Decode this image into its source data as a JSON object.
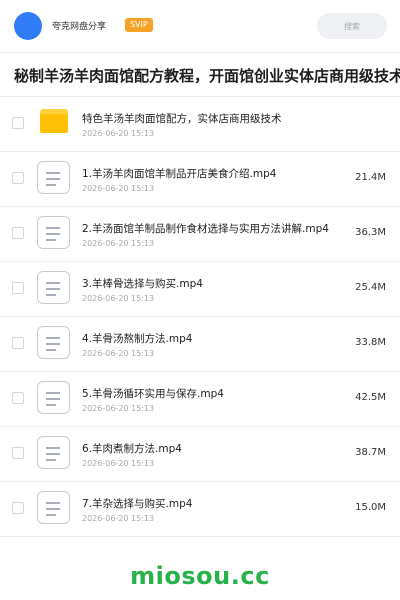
{
  "header": {
    "app_name": "夸克网盘分享",
    "badge": "SVIP",
    "search_placeholder": "搜索"
  },
  "page": {
    "title": "秘制羊汤羊肉面馆配方教程，开面馆创业实体店商用级技术"
  },
  "colors": {
    "accent": "#2f7cf6",
    "badge": "#f6a128",
    "folder": "#ffc107",
    "watermark": "#27b24a"
  },
  "files": [
    {
      "type": "folder",
      "icon": "folder-icon",
      "name": "特色羊汤羊肉面馆配方，实体店商用级技术",
      "date": "2026-06-20 15:13",
      "size": ""
    },
    {
      "type": "file",
      "icon": "file-icon",
      "name": "1.羊汤羊肉面馆羊制品开店美食介绍.mp4",
      "date": "2026-06-20 15:13",
      "size": "21.4M"
    },
    {
      "type": "file",
      "icon": "file-icon",
      "name": "2.羊汤面馆羊制品制作食材选择与实用方法讲解.mp4",
      "date": "2026-06-20 15:13",
      "size": "36.3M"
    },
    {
      "type": "file",
      "icon": "file-icon",
      "name": "3.羊棒骨选择与购买.mp4",
      "date": "2026-06-20 15:13",
      "size": "25.4M"
    },
    {
      "type": "file",
      "icon": "file-icon",
      "name": "4.羊骨汤熬制方法.mp4",
      "date": "2026-06-20 15:13",
      "size": "33.8M"
    },
    {
      "type": "file",
      "icon": "file-icon",
      "name": "5.羊骨汤循环实用与保存.mp4",
      "date": "2026-06-20 15:13",
      "size": "42.5M"
    },
    {
      "type": "file",
      "icon": "file-icon",
      "name": "6.羊肉煮制方法.mp4",
      "date": "2026-06-20 15:13",
      "size": "38.7M"
    },
    {
      "type": "file",
      "icon": "file-icon",
      "name": "7.羊杂选择与购买.mp4",
      "date": "2026-06-20 15:13",
      "size": "15.0M"
    }
  ],
  "watermark": "miosou.cc"
}
